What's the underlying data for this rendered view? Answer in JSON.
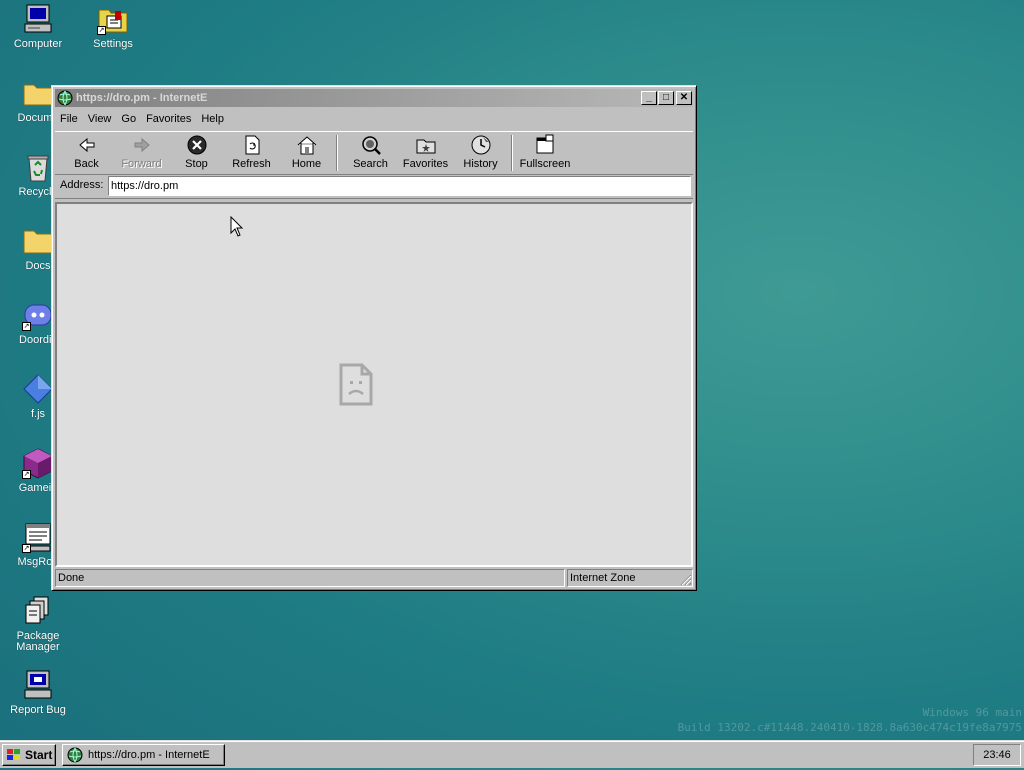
{
  "desktop": {
    "icons": [
      {
        "label": "Computer",
        "icon": "computer-icon"
      },
      {
        "label": "Settings",
        "icon": "settings-icon"
      },
      {
        "label": "Docume",
        "icon": "folder-icon"
      },
      {
        "label": "Recycle",
        "icon": "recycle-bin-icon"
      },
      {
        "label": "Docs",
        "icon": "folder-icon"
      },
      {
        "label": "Doordis",
        "icon": "discord-icon"
      },
      {
        "label": "f.js",
        "icon": "diamond-icon"
      },
      {
        "label": "Gamein",
        "icon": "cube-icon"
      },
      {
        "label": "MsgRoo",
        "icon": "message-room-icon"
      },
      {
        "label": "Package Manager",
        "icon": "package-icon"
      },
      {
        "label": "Report Bug",
        "icon": "report-bug-icon"
      }
    ],
    "watermark": {
      "line1": "Windows 96 main",
      "line2": "Build 13202.c#11448.240410-1828.8a630c474c19fe8a7975"
    }
  },
  "window": {
    "title": "https://dro.pm - InternetE",
    "title_icon": "globe-icon",
    "buttons": {
      "minimize": "_",
      "maximize": "□",
      "close": "✕"
    },
    "menu": [
      "File",
      "View",
      "Go",
      "Favorites",
      "Help"
    ],
    "toolbar": [
      {
        "label": "Back",
        "icon": "back-arrow-icon",
        "enabled": true
      },
      {
        "label": "Forward",
        "icon": "forward-arrow-icon",
        "enabled": false
      },
      {
        "label": "Stop",
        "icon": "stop-icon",
        "enabled": true
      },
      {
        "label": "Refresh",
        "icon": "refresh-icon",
        "enabled": true
      },
      {
        "label": "Home",
        "icon": "home-icon",
        "enabled": true
      },
      {
        "label": "Search",
        "icon": "search-icon",
        "enabled": true
      },
      {
        "label": "Favorites",
        "icon": "favorites-icon",
        "enabled": true
      },
      {
        "label": "History",
        "icon": "history-icon",
        "enabled": true
      },
      {
        "label": "Fullscreen",
        "icon": "fullscreen-icon",
        "enabled": true
      }
    ],
    "address": {
      "label": "Address:",
      "value": "https://dro.pm"
    },
    "content": {
      "state_icon": "sad-page-icon"
    },
    "status": {
      "text": "Done",
      "zone": "Internet Zone"
    }
  },
  "taskbar": {
    "start_label": "Start",
    "items": [
      {
        "label": "https://dro.pm - InternetE",
        "icon": "globe-icon"
      }
    ],
    "clock": "23:46"
  },
  "colors": {
    "desktop_teal": "#2a8a8a",
    "window_gray": "#c0c0c0",
    "title_inactive": "#808080",
    "content_bg": "#dedede"
  }
}
